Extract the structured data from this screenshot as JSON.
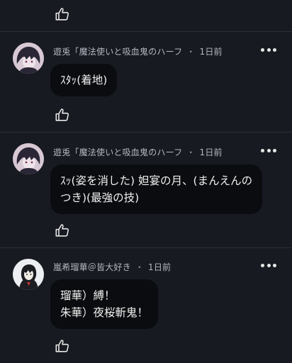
{
  "comments": [
    {
      "author": "遊兎「魔法使いと吸血鬼のハーフ",
      "time": "1日前",
      "separator": "・",
      "text": "ｽﾀｯ(着地)"
    },
    {
      "author": "遊兎「魔法使いと吸血鬼のハーフ",
      "time": "1日前",
      "separator": "・",
      "text": "ｽｯ(姿を消した) 妲宴の月、(まんえんの\nつき)(最強の技)"
    },
    {
      "author": "嵐希瑠華＠皆大好き",
      "time": "1日前",
      "separator": "・",
      "text": "瑠華）縛！\n朱華）夜桜斬鬼！"
    }
  ],
  "icons": {
    "like": "thumbs-up-icon",
    "more": "more-horizontal-icon"
  },
  "colors": {
    "background": "#171a21",
    "bubble": "#0b0c0f",
    "meta_text": "#b4b8c0"
  }
}
